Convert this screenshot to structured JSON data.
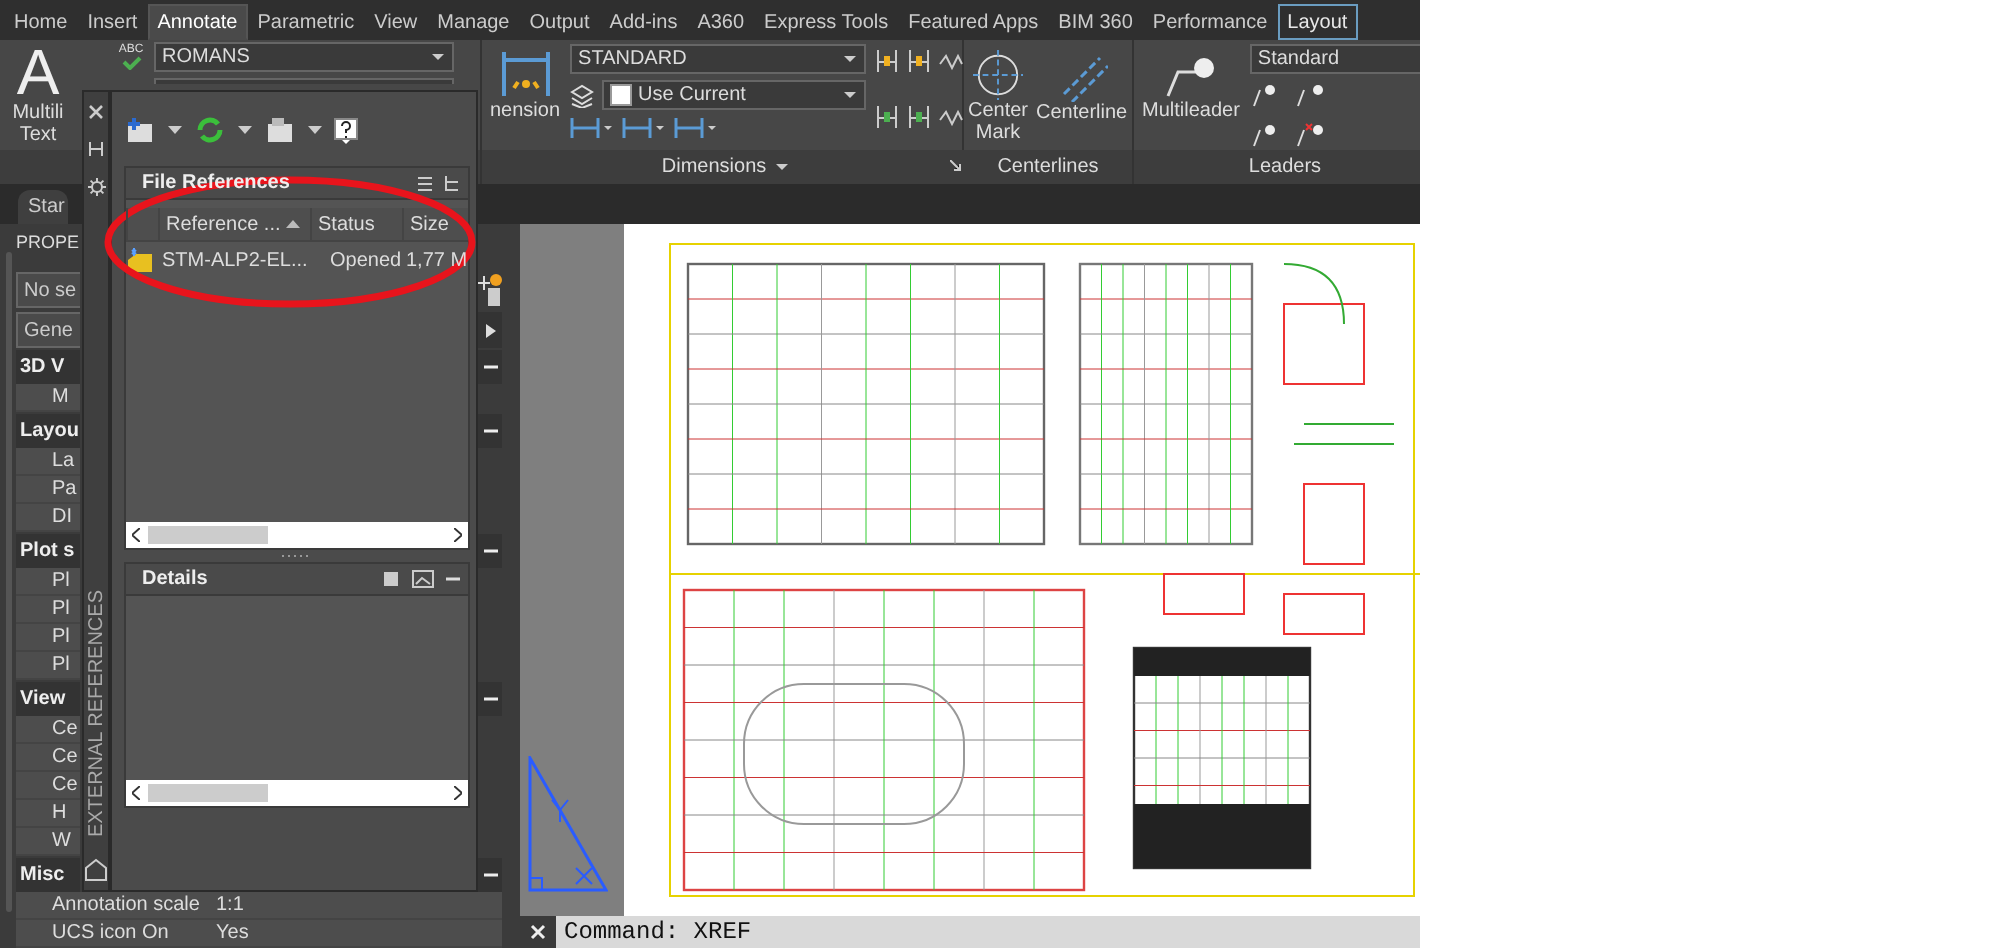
{
  "ribbon_tabs": [
    {
      "label": "Home",
      "selected": false,
      "kind": "standard"
    },
    {
      "label": "Insert",
      "selected": false,
      "kind": "standard"
    },
    {
      "label": "Annotate",
      "selected": true,
      "kind": "standard"
    },
    {
      "label": "Parametric",
      "selected": false,
      "kind": "standard"
    },
    {
      "label": "View",
      "selected": false,
      "kind": "standard"
    },
    {
      "label": "Manage",
      "selected": false,
      "kind": "standard"
    },
    {
      "label": "Output",
      "selected": false,
      "kind": "standard"
    },
    {
      "label": "Add-ins",
      "selected": false,
      "kind": "standard"
    },
    {
      "label": "A360",
      "selected": false,
      "kind": "standard"
    },
    {
      "label": "Express Tools",
      "selected": false,
      "kind": "standard"
    },
    {
      "label": "Featured Apps",
      "selected": false,
      "kind": "standard"
    },
    {
      "label": "BIM 360",
      "selected": false,
      "kind": "standard"
    },
    {
      "label": "Performance",
      "selected": false,
      "kind": "standard"
    },
    {
      "label": "Layout",
      "selected": false,
      "kind": "contextual"
    }
  ],
  "ribbon": {
    "text_panel": {
      "glyph": "A",
      "button_lines": [
        "Multili",
        "Text"
      ],
      "spell_label": "ABC",
      "text_style": "ROMANS"
    },
    "dimensions_panel": {
      "button_label": "nension",
      "dim_style": "STANDARD",
      "layer": "Use Current",
      "title": "Dimensions"
    },
    "centerlines_panel": {
      "buttons": [
        {
          "lines": [
            "Center",
            "Mark"
          ]
        },
        {
          "lines": [
            "Centerline"
          ]
        }
      ],
      "title": "Centerlines"
    },
    "leaders_panel": {
      "button": "Multileader",
      "style": "Standard",
      "title": "Leaders"
    }
  },
  "file_tab": "Star",
  "properties_palette": {
    "title": "PROPE",
    "selection": "No se",
    "category": "Gene",
    "sections": [
      {
        "label": "3D V",
        "expanded": true,
        "rows": [
          {
            "name": "M"
          }
        ]
      },
      {
        "label": "Layou",
        "expanded": true,
        "rows": [
          {
            "name": "La"
          },
          {
            "name": "Pa"
          },
          {
            "name": "DI"
          }
        ]
      },
      {
        "label": "Plot s",
        "expanded": true,
        "rows": [
          {
            "name": "Pl"
          },
          {
            "name": "Pl"
          },
          {
            "name": "Pl"
          },
          {
            "name": "Pl"
          }
        ]
      },
      {
        "label": "View",
        "expanded": true,
        "rows": [
          {
            "name": "Ce"
          },
          {
            "name": "Ce"
          },
          {
            "name": "Ce"
          },
          {
            "name": "H"
          },
          {
            "name": "W"
          }
        ]
      },
      {
        "label": "Misc",
        "expanded": true,
        "rows": [
          {
            "name": "Annotation scale",
            "value": "1:1"
          },
          {
            "name": "UCS icon On",
            "value": "Yes"
          }
        ]
      }
    ]
  },
  "xref_palette": {
    "side_title": "EXTERNAL REFERENCES",
    "file_references": {
      "title": "File References",
      "columns": [
        {
          "label": "Reference ...",
          "sorted": true
        },
        {
          "label": "Status",
          "sorted": false
        },
        {
          "label": "Size",
          "sorted": false
        }
      ],
      "rows": [
        {
          "name": "STM-ALP2-EL...",
          "status": "Opened",
          "size": "1,77 M"
        }
      ]
    },
    "details": {
      "title": "Details"
    }
  },
  "command_line": {
    "text": "Command: XREF"
  }
}
